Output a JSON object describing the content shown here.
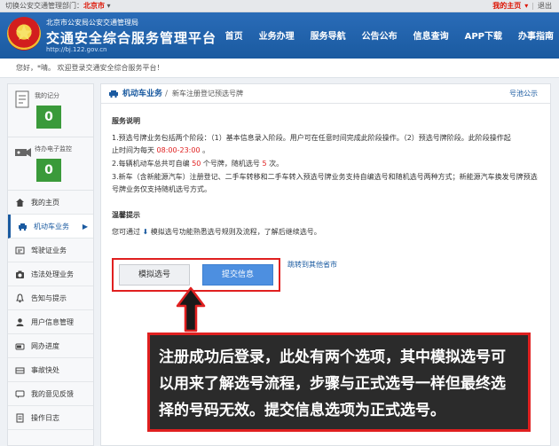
{
  "topbar": {
    "switch_label": "切换公安交通管理部门：",
    "city": "北京市",
    "my_home": "我的主页",
    "logout": "退出"
  },
  "header": {
    "subtitle": "北京市公安局公安交通管理局",
    "title": "交通安全综合服务管理平台",
    "url": "http://bj.122.gov.cn",
    "nav": [
      "首页",
      "业务办理",
      "服务导航",
      "公告公布",
      "信息查询",
      "APP下载",
      "办事指南"
    ]
  },
  "welcome": "您好，*晴。 欢迎登录交通安全综合服务平台！",
  "sidebar": {
    "score_label": "我的记分",
    "score_value": "0",
    "ticket_label": "待办电子监控",
    "ticket_value": "0",
    "items": [
      {
        "label": "我的主页",
        "icon": "home-icon"
      },
      {
        "label": "机动车业务",
        "icon": "car-icon"
      },
      {
        "label": "驾驶证业务",
        "icon": "license-icon"
      },
      {
        "label": "违法处理业务",
        "icon": "camera-icon"
      },
      {
        "label": "告知与提示",
        "icon": "bell-icon"
      },
      {
        "label": "用户信息管理",
        "icon": "user-icon"
      },
      {
        "label": "网办进度",
        "icon": "progress-icon"
      },
      {
        "label": "事故快处",
        "icon": "accident-icon"
      },
      {
        "label": "我的意见反馈",
        "icon": "feedback-icon"
      },
      {
        "label": "操作日志",
        "icon": "log-icon"
      }
    ]
  },
  "breadcrumb": {
    "section": "机动车业务",
    "sep": "/",
    "page": "新车注册登记预选号牌",
    "right_link": "号池公示"
  },
  "service": {
    "title": "服务说明",
    "p1_a": "1.预选号牌业务包括两个阶段：（1）基本信息录入阶段。用户可在任意时间完成此阶段操作。（2）预选号牌阶段。此阶段操作起",
    "p1_b": "止时间为每天 ",
    "p1_time": "08:00-23:00",
    "p1_c": " 。",
    "p2_a": "2.每辆机动车总共可自编 ",
    "p2_n1": "50",
    "p2_b": " 个号牌，随机选号 ",
    "p2_n2": "5",
    "p2_c": " 次。",
    "p3": "3.新车（含新能源汽车）注册登记、二手车转移和二手车转入预选号牌业务支持自编选号和随机选号两种方式；新能源汽车换发号牌预选号牌业务仅支持随机选号方式。"
  },
  "tips": {
    "title": "温馨提示",
    "text_a": "您可通过",
    "text_b": "模拟选号功能熟悉选号规则及流程，了解后继续选号。"
  },
  "buttons": {
    "simulate": "模拟选号",
    "submit": "提交信息",
    "jump": "跳转到其他省市"
  },
  "annotation": "注册成功后登录，此处有两个选项，其中模拟选号可以用来了解选号流程，步骤与正式选号一样但最终选择的号码无效。提交信息选项为正式选号。",
  "colors": {
    "brand": "#1a5aa0",
    "accent_red": "#e02020",
    "score_green": "#3a9a3a",
    "submit_blue": "#4d8fe0"
  }
}
